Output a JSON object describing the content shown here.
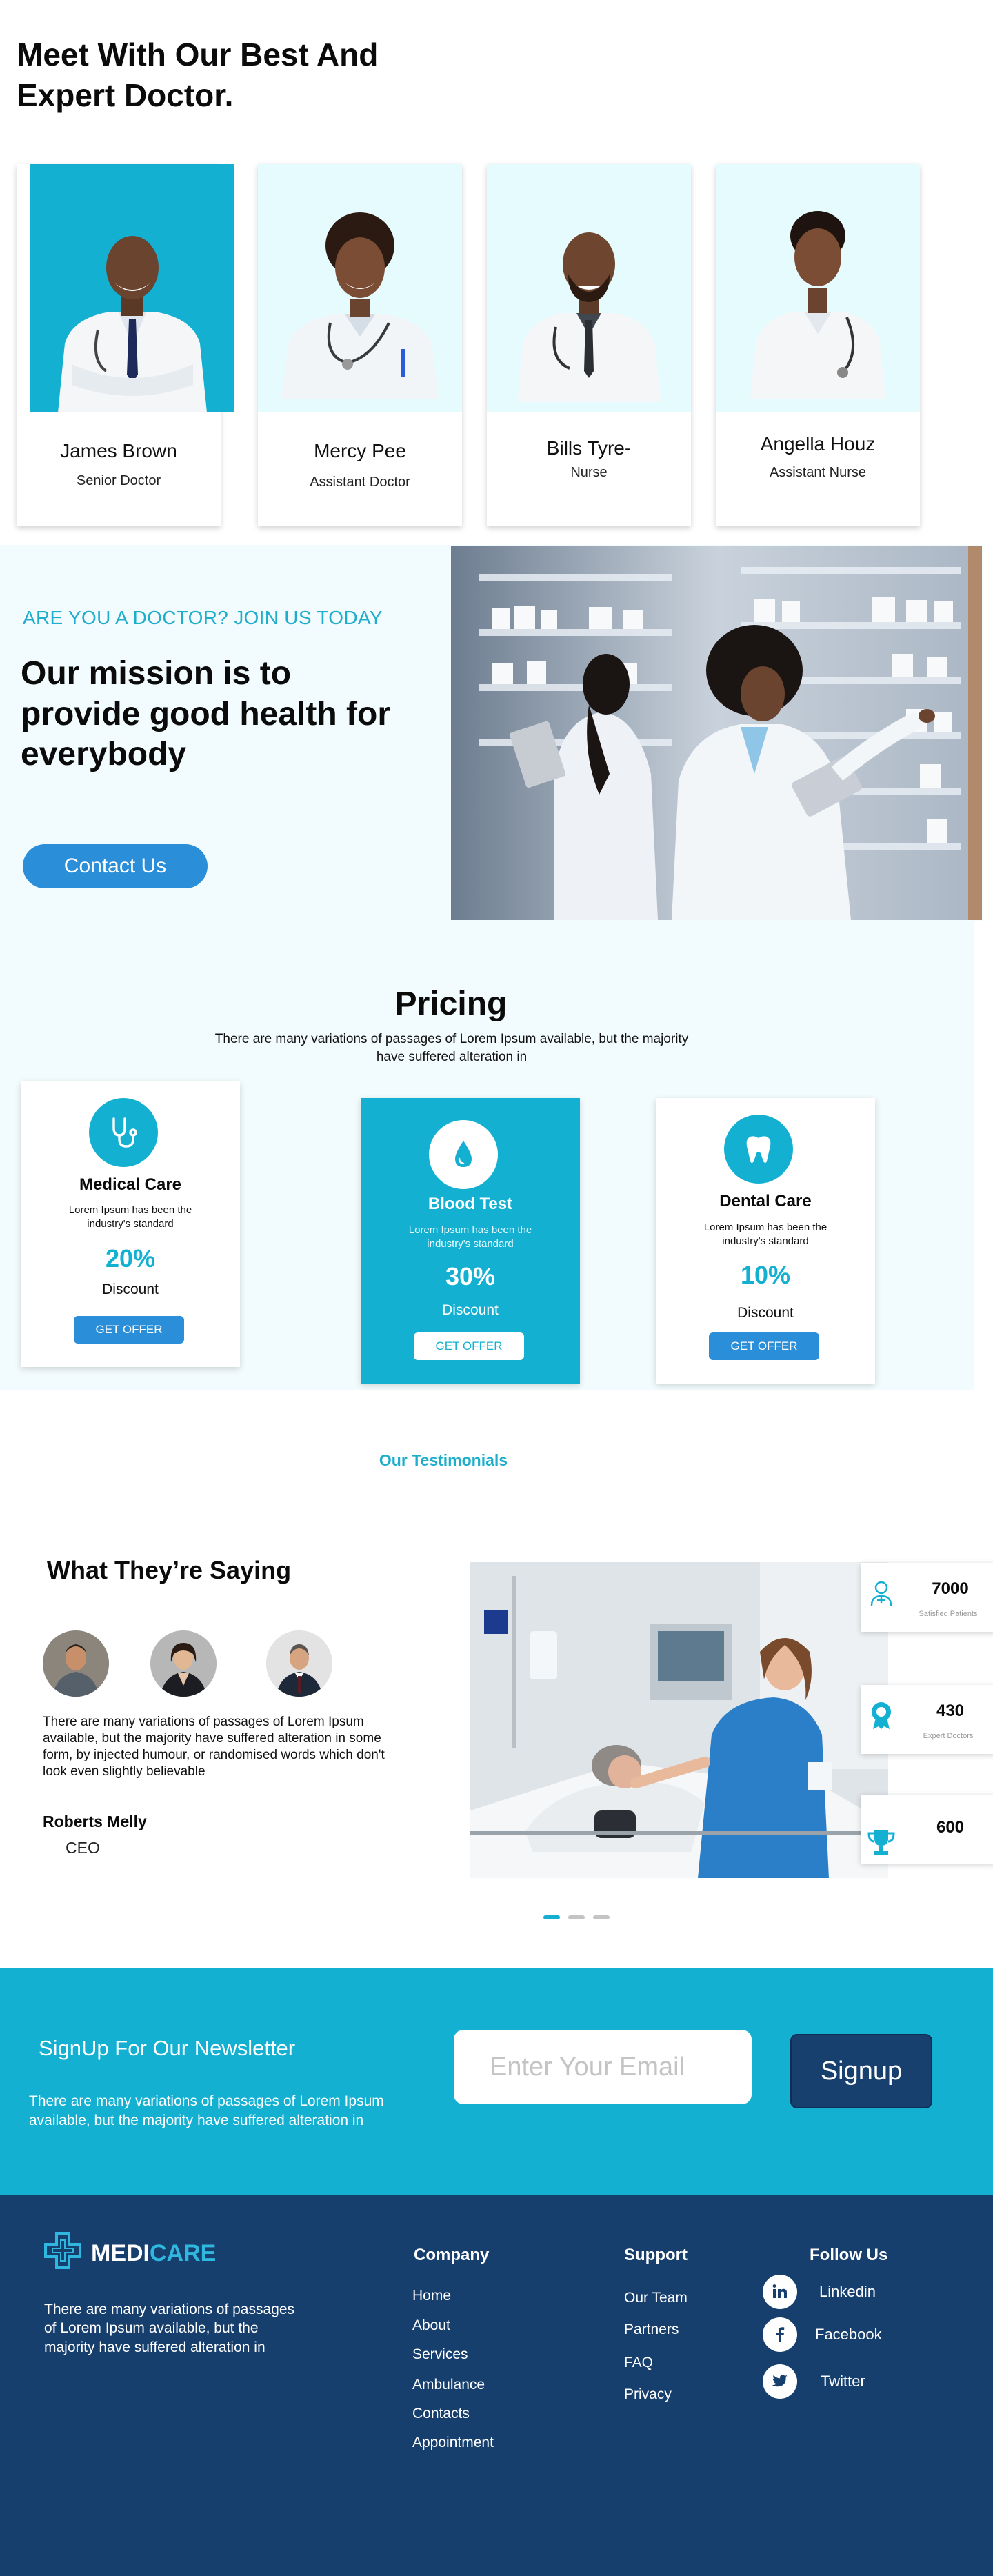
{
  "team": {
    "title": "Meet With Our Best And Expert Doctor.",
    "doctors": [
      {
        "name": "James Brown",
        "role": "Senior Doctor",
        "bg": "#13b0d2"
      },
      {
        "name": "Mercy Pee",
        "role": "Assistant Doctor",
        "bg": "#e6fbfd"
      },
      {
        "name": "Bills Tyre-",
        "role": "Nurse",
        "bg": "#e6fbfd"
      },
      {
        "name": "Angella Houz",
        "role": "Assistant Nurse",
        "bg": "#e6fbfd"
      }
    ]
  },
  "mission": {
    "eyebrow": "ARE YOU A DOCTOR? JOIN US TODAY",
    "heading": "Our mission is to provide good health for everybody",
    "button": "Contact Us"
  },
  "pricing": {
    "title": "Pricing",
    "subtitle": "There are many variations of passages of Lorem Ipsum available, but the majority have suffered alteration in",
    "plans": [
      {
        "title": "Medical Care",
        "desc": "Lorem Ipsum has been the industry's standard",
        "percent": "20%",
        "discount": "Discount",
        "button": "GET OFFER",
        "icon": "stethoscope-icon"
      },
      {
        "title": "Blood Test",
        "desc": "Lorem Ipsum has been the industry's standard",
        "percent": "30%",
        "discount": "Discount",
        "button": "GET OFFER",
        "icon": "blood-drop-icon"
      },
      {
        "title": "Dental Care",
        "desc": "Lorem Ipsum has been the industry's standard",
        "percent": "10%",
        "discount": "Discount",
        "button": "GET OFFER",
        "icon": "tooth-icon"
      }
    ]
  },
  "testimonials": {
    "eyebrow": "Our Testimonials",
    "heading": "What They’re Saying",
    "quote": "There are many variations of passages of Lorem Ipsum available, but the majority have suffered alteration in some form, by injected humour, or randomised words which don't look even slightly believable",
    "author": "Roberts  Melly",
    "author_role": "CEO",
    "stats": [
      {
        "number": "7000",
        "label": "Satisfied Patients",
        "icon": "patient-icon"
      },
      {
        "number": "430",
        "label": "Expert Doctors",
        "icon": "award-badge-icon"
      },
      {
        "number": "600",
        "label": "",
        "icon": "trophy-icon"
      }
    ]
  },
  "newsletter": {
    "title": "SignUp For Our Newsletter",
    "text": "There are many variations of passages of Lorem Ipsum available, but the majority have suffered alteration in",
    "email_placeholder": "Enter Your Email",
    "button": "Signup"
  },
  "footer": {
    "logo_part1": "MEDI",
    "logo_part2": "CARE",
    "description": "There are many variations of passages of Lorem Ipsum available, but the majority have suffered alteration in",
    "company": {
      "title": "Company",
      "links": [
        "Home",
        "About",
        "Services",
        "Ambulance",
        "Contacts",
        "Appointment"
      ]
    },
    "support": {
      "title": "Support",
      "links": [
        "Our Team",
        "Partners",
        "FAQ",
        "Privacy"
      ]
    },
    "follow": {
      "title": "Follow Us",
      "links": [
        "Linkedin",
        "Facebook",
        "Twitter"
      ]
    }
  },
  "colors": {
    "accent": "#13b0d2",
    "button_blue": "#2a8ed8",
    "navy": "#173f6e"
  }
}
